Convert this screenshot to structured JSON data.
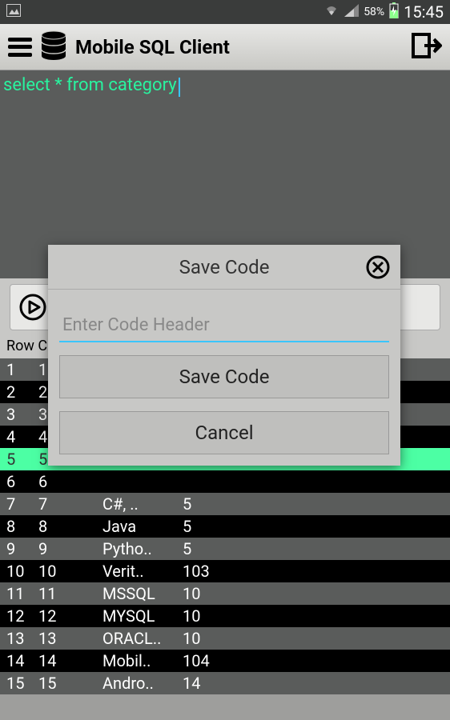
{
  "status_bar": {
    "battery_percent": "58%",
    "time": "15:45"
  },
  "header": {
    "title": "Mobile SQL Client"
  },
  "query": {
    "text": "select * from category"
  },
  "table": {
    "header_left": "Row C",
    "rows": [
      {
        "n": "1",
        "id": "1",
        "name": "",
        "v": ""
      },
      {
        "n": "2",
        "id": "2",
        "name": "",
        "v": ""
      },
      {
        "n": "3",
        "id": "3",
        "name": "",
        "v": ""
      },
      {
        "n": "4",
        "id": "4",
        "name": "",
        "v": ""
      },
      {
        "n": "5",
        "id": "5",
        "name": "",
        "v": ""
      },
      {
        "n": "6",
        "id": "6",
        "name": "",
        "v": ""
      },
      {
        "n": "7",
        "id": "7",
        "name": "C#, ..",
        "v": "5"
      },
      {
        "n": "8",
        "id": "8",
        "name": "Java",
        "v": "5"
      },
      {
        "n": "9",
        "id": "9",
        "name": "Pytho..",
        "v": "5"
      },
      {
        "n": "10",
        "id": "10",
        "name": "Verit..",
        "v": "103"
      },
      {
        "n": "11",
        "id": "11",
        "name": "MSSQL",
        "v": "10"
      },
      {
        "n": "12",
        "id": "12",
        "name": "MYSQL",
        "v": "10"
      },
      {
        "n": "13",
        "id": "13",
        "name": "ORACL..",
        "v": "10"
      },
      {
        "n": "14",
        "id": "14",
        "name": "Mobil..",
        "v": "104"
      },
      {
        "n": "15",
        "id": "15",
        "name": "Andro..",
        "v": "14"
      }
    ],
    "selected_index": 4
  },
  "modal": {
    "title": "Save Code",
    "input_placeholder": "Enter Code Header",
    "save_label": "Save Code",
    "cancel_label": "Cancel"
  }
}
